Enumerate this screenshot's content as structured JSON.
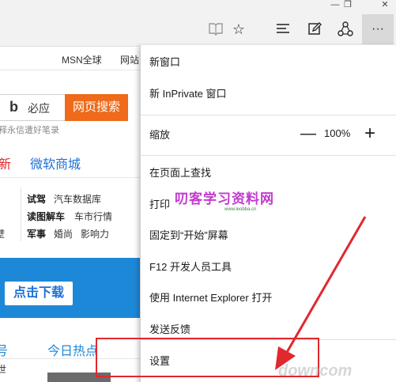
{
  "colors": {
    "accent_red": "#e0282e",
    "search_orange": "#ef6a1a",
    "banner_blue": "#1e88d8",
    "link_blue": "#1e6fd6",
    "watermark_purple": "#c23ad0"
  },
  "toolbar": {
    "icons": [
      "reading-view-icon",
      "favorite-star-icon",
      "hub-icon",
      "web-note-icon",
      "share-icon",
      "more-icon"
    ],
    "more_label": "···"
  },
  "page": {
    "top_links": [
      "MSN全球",
      "网站"
    ],
    "search_label": "必应",
    "search_button": "网页搜索",
    "search_hint": "释永信遭好笔录",
    "nav": [
      "新",
      "微软商城"
    ],
    "rows": [
      [
        "试驾",
        "汽车数据库"
      ],
      [
        "读图解车",
        "车市行情"
      ],
      [
        "军事",
        "婚尚",
        "影响力"
      ]
    ],
    "left_fragments": [
      "壁"
    ],
    "download_button": "点击下载",
    "section_left": "号",
    "section_right": "今日热点",
    "bottom_fragment": "世"
  },
  "menu": {
    "new_window": "新窗口",
    "new_inprivate": "新 InPrivate 窗口",
    "zoom_label": "缩放",
    "zoom_minus": "—",
    "zoom_value": "100%",
    "zoom_plus": "+",
    "find": "在页面上查找",
    "print": "打印",
    "pin_start": "固定到“开始”屏幕",
    "f12": "F12 开发人员工具",
    "open_ie": "使用 Internet Explorer 打开",
    "feedback": "发送反馈",
    "settings": "设置"
  },
  "overlay": {
    "watermark_cn": "叨客学习资料网",
    "watermark_url": "www.leobba.cn",
    "bottom_watermark": "downcom"
  }
}
